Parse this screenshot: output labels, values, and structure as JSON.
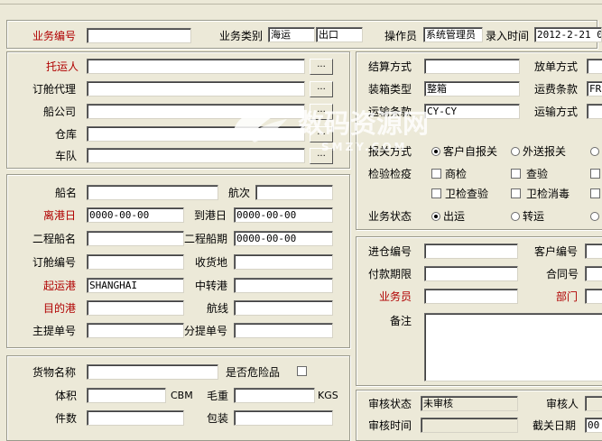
{
  "top": {
    "business_no_label": "业务编号",
    "business_no_value": "",
    "business_type_label": "业务类别",
    "business_type_1": "海运",
    "business_type_2": "出口",
    "operator_label": "操作员",
    "operator_value": "系统管理员",
    "entry_time_label": "录入时间",
    "entry_time_value": "2012-2-21 0"
  },
  "consign": {
    "shipper_label": "托运人",
    "booking_agent_label": "订舱代理",
    "carrier_label": "船公司",
    "warehouse_label": "仓库",
    "fleet_label": "车队",
    "browse": "..."
  },
  "voyage": {
    "vessel_label": "船名",
    "voyage_label": "航次",
    "departure_date_label": "离港日",
    "departure_date_value": "0000-00-00",
    "arrival_date_label": "到港日",
    "arrival_date_value": "0000-00-00",
    "second_vessel_label": "二程船名",
    "second_date_label": "二程船期",
    "second_date_value": "0000-00-00",
    "booking_no_label": "订舱编号",
    "receipt_place_label": "收货地",
    "pol_label": "起运港",
    "pol_value": "SHANGHAI",
    "transit_label": "中转港",
    "destination_label": "目的港",
    "route_label": "航线",
    "mbl_label": "主提单号",
    "hbl_label": "分提单号"
  },
  "cargo": {
    "goods_label": "货物名称",
    "dangerous_label": "是否危险品",
    "volume_label": "体积",
    "volume_unit": "CBM",
    "weight_label": "毛重",
    "weight_unit": "KGS",
    "pieces_label": "件数",
    "package_label": "包装"
  },
  "settle": {
    "settle_label": "结算方式",
    "release_label": "放单方式",
    "packing_label": "装箱类型",
    "packing_value": "整箱",
    "freight_label": "运费条款",
    "freight_value": "FRE",
    "terms_label": "运输条款",
    "terms_value": "CY-CY",
    "transport_label": "运输方式",
    "customs_label": "报关方式",
    "customs_opt1": "客户自报关",
    "customs_opt2": "外送报关",
    "inspect_label": "检验检疫",
    "inspect_opt1": "商检",
    "inspect_opt2": "查验",
    "inspect_opt3": "卫检查验",
    "inspect_opt4": "卫检消毒",
    "status_label": "业务状态",
    "status_opt1": "出运",
    "status_opt2": "转运"
  },
  "misc": {
    "entry_no_label": "进仓编号",
    "customer_no_label": "客户编号",
    "payment_label": "付款期限",
    "contract_label": "合同号",
    "salesman_label": "业务员",
    "department_label": "部门",
    "remarks_label": "备注"
  },
  "audit": {
    "status_label": "审核状态",
    "status_value": "未审核",
    "auditor_label": "审核人",
    "time_label": "审核时间",
    "cutoff_label": "截关日期",
    "cutoff_value": "00"
  },
  "watermark": {
    "brand": "数码资源网",
    "url": "SMZY.COM"
  }
}
